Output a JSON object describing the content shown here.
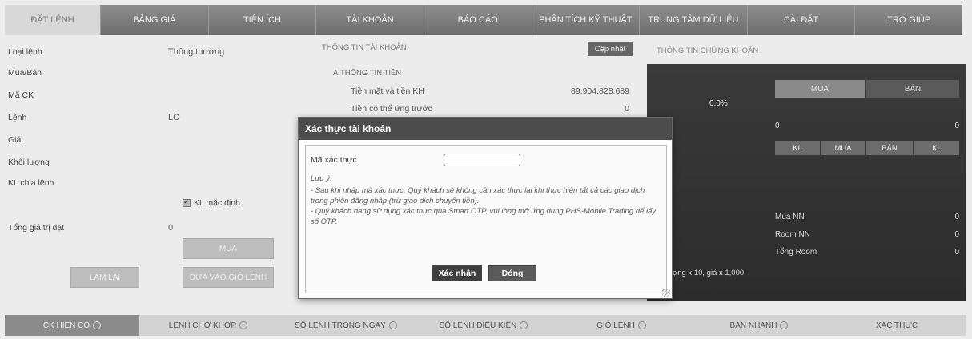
{
  "topnav": {
    "tabs": [
      {
        "label": "ĐẶT LỆNH",
        "active": true
      },
      {
        "label": "BẢNG GIÁ"
      },
      {
        "label": "TIỆN ÍCH"
      },
      {
        "label": "TÀI KHOẢN"
      },
      {
        "label": "BÁO CÁO"
      },
      {
        "label": "PHÂN TÍCH KỸ THUẬT"
      },
      {
        "label": "TRUNG TÂM DỮ LIỆU"
      },
      {
        "label": "CÀI ĐẶT"
      },
      {
        "label": "TRỢ GIÚP"
      }
    ]
  },
  "order": {
    "loai_lenh_label": "Loại lệnh",
    "loai_lenh_value": "Thông thường",
    "mua_ban_label": "Mua/Bán",
    "ma_ck_label": "Mã CK",
    "lenh_label": "Lệnh",
    "lenh_value": "LO",
    "gia_label": "Giá",
    "khoi_luong_label": "Khối lượng",
    "kl_chia_lenh_label": "KL chia lệnh",
    "kl_mac_dinh_label": "KL mặc định",
    "tong_gia_tri_label": "Tổng giá trị đặt",
    "tong_gia_tri_value": "0",
    "mua_button": "MUA",
    "lam_lai_button": "LÀM LẠI",
    "dua_vao_gio_button": "ĐƯA VÀO GIỎ LỆNH"
  },
  "account": {
    "header": "THÔNG TIN TÀI KHOẢN",
    "update_button": "Cập nhật",
    "subheader": "A.THÔNG TIN TIỀN",
    "cash_label": "Tiền mặt và tiền KH",
    "cash_value": "89.904.828.689",
    "advance_label": "Tiền có thể ứng trước",
    "advance_value": "0"
  },
  "stock": {
    "header": "THÔNG TIN CHỨNG KHOÁN",
    "pct": "0.0%",
    "mua": "MUA",
    "ban": "BÁN",
    "zero_left": "0",
    "zero_right": "0",
    "cols": [
      "KL",
      "MUA",
      "BÁN",
      "KL"
    ],
    "mua_nn_label": "Mua NN",
    "mua_nn_value": "0",
    "room_nn_label": "Room NN",
    "room_nn_value": "0",
    "tong_room_label": "Tổng Room",
    "tong_room_value": "0",
    "unit_note": "ợng x 10, giá x 1,000"
  },
  "modal": {
    "title": "Xác thực tài khoản",
    "code_label": "Mã xác thực",
    "code_value": "",
    "note_title": "Lưu ý:",
    "note_line1": "- Sau khi nhập mã xác thực, Quý khách sẽ không cần xác thực lại khi thực hiện tất cả các giao dịch trong phiên đăng nhập (trừ giao dịch chuyển tiền).",
    "note_line2": "- Quý khách đang sử dụng xác thực qua Smart OTP, vui lòng mở ứng dụng PHS-Mobile Trading để lấy số OTP.",
    "confirm_button": "Xác nhận",
    "close_button": "Đóng"
  },
  "bottomnav": {
    "tabs": [
      {
        "label": "CK HIỆN CÓ",
        "active": true
      },
      {
        "label": "LỆNH CHỜ KHỚP"
      },
      {
        "label": "SỔ LỆNH TRONG NGÀY"
      },
      {
        "label": "SỔ LỆNH ĐIỀU KIỆN"
      },
      {
        "label": "GIỎ LỆNH"
      },
      {
        "label": "BÁN NHANH"
      },
      {
        "label": "XÁC THỰC"
      }
    ]
  }
}
